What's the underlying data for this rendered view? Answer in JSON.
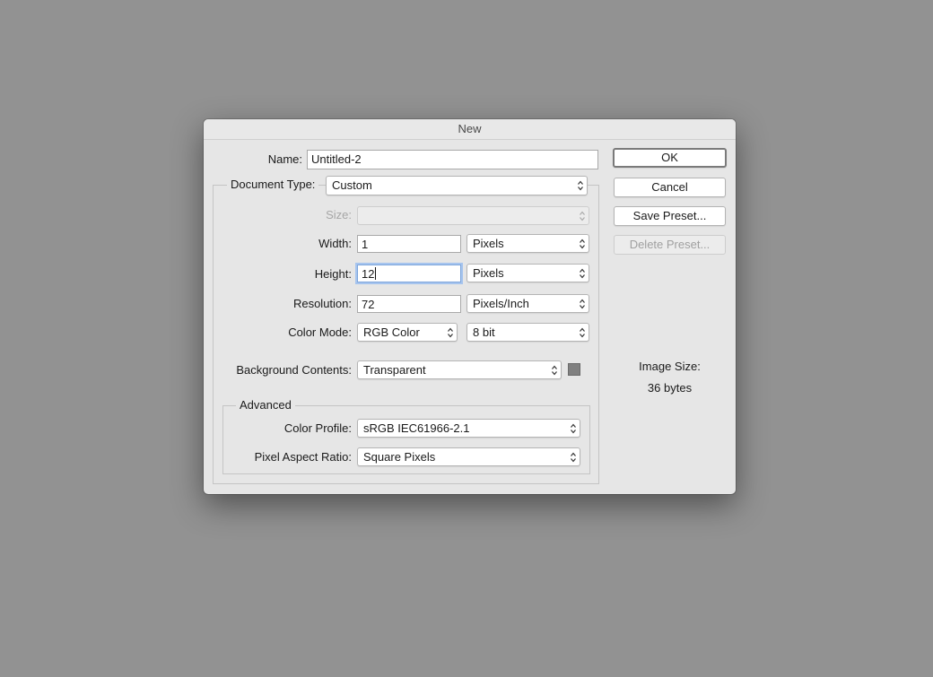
{
  "dialog": {
    "title": "New"
  },
  "name": {
    "label": "Name:",
    "value": "Untitled-2"
  },
  "document_type": {
    "label": "Document Type:",
    "value": "Custom"
  },
  "size": {
    "label": "Size:",
    "value": ""
  },
  "width": {
    "label": "Width:",
    "value": "1",
    "unit": "Pixels"
  },
  "height": {
    "label": "Height:",
    "value": "12",
    "unit": "Pixels"
  },
  "resolution": {
    "label": "Resolution:",
    "value": "72",
    "unit": "Pixels/Inch"
  },
  "color_mode": {
    "label": "Color Mode:",
    "value": "RGB Color",
    "depth": "8 bit"
  },
  "background": {
    "label": "Background Contents:",
    "value": "Transparent",
    "swatch_color": "#808080"
  },
  "advanced": {
    "title": "Advanced",
    "color_profile": {
      "label": "Color Profile:",
      "value": "sRGB IEC61966-2.1"
    },
    "pixel_aspect": {
      "label": "Pixel Aspect Ratio:",
      "value": "Square Pixels"
    }
  },
  "buttons": {
    "ok": "OK",
    "cancel": "Cancel",
    "save_preset": "Save Preset...",
    "delete_preset": "Delete Preset..."
  },
  "image_size": {
    "label": "Image Size:",
    "value": "36 bytes"
  },
  "icons": {
    "select_arrows": "up-down-chevron-icon"
  }
}
